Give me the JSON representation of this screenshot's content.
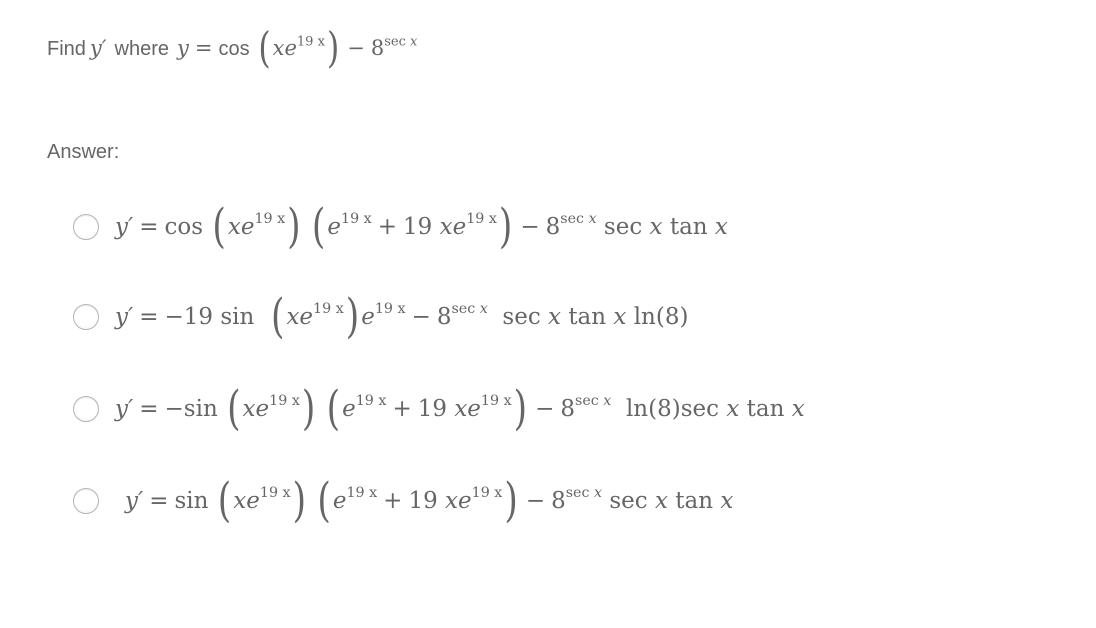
{
  "question": {
    "prefix": "Find",
    "target": "y′",
    "where": "where",
    "expression": {
      "lhs": "y",
      "eq": "=",
      "fn1": "cos",
      "arg_x": "x",
      "arg_e": "e",
      "arg_exp": "19 x",
      "minus": "−",
      "base": "8",
      "base_exp_fn": "sec",
      "base_exp_var": "x"
    },
    "plain_text": "Find y' where y = cos(xe^(19x)) − 8^(sec x)"
  },
  "answer_label": "Answer:",
  "options": [
    {
      "plain_text": "y' = cos(xe^(19x))(e^(19x) + 19xe^(19x)) − 8^(sec x) sec x tan x",
      "lhs": "y′",
      "eq": "=",
      "fn": "cos",
      "x": "x",
      "e": "e",
      "exp": "19 x",
      "plus": "+",
      "coef": "19",
      "minus": "−",
      "base": "8",
      "sec": "sec",
      "tan": "tan",
      "selected": false
    },
    {
      "plain_text": "y' = −19 sin(xe^(19x)) e^(19x) − 8^(sec x) sec x tan x ln(8)",
      "lhs": "y′",
      "eq": "=",
      "coef": "−19",
      "fn": "sin",
      "x": "x",
      "e": "e",
      "exp": "19 x",
      "minus": "−",
      "base": "8",
      "sec": "sec",
      "tan": "tan",
      "ln": "ln",
      "ln_arg": "(8)",
      "selected": false
    },
    {
      "plain_text": "y' = −sin(xe^(19x))(e^(19x) + 19xe^(19x)) − 8^(sec x) ln(8) sec x tan x",
      "lhs": "y′",
      "eq": "=",
      "neg": "−",
      "fn": "sin",
      "x": "x",
      "e": "e",
      "exp": "19 x",
      "plus": "+",
      "coef": "19",
      "minus": "−",
      "base": "8",
      "sec": "sec",
      "tan": "tan",
      "ln": "ln",
      "ln_arg": "(8)",
      "selected": false
    },
    {
      "plain_text": "y' = sin(xe^(19x))(e^(19x) + 19xe^(19x)) − 8^(sec x) sec x tan x",
      "lhs": "y′",
      "eq": "=",
      "fn": "sin",
      "x": "x",
      "e": "e",
      "exp": "19 x",
      "plus": "+",
      "coef": "19",
      "minus": "−",
      "base": "8",
      "sec": "sec",
      "tan": "tan",
      "selected": false
    }
  ],
  "symbols": {
    "lparen": "(",
    "rparen": ")"
  }
}
